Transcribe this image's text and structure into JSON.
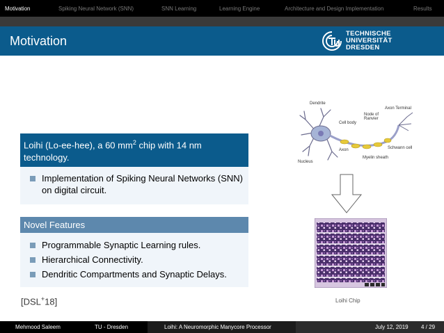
{
  "nav": {
    "items": [
      {
        "label": "Motivation",
        "active": true
      },
      {
        "label": "Spiking Neural Network (SNN)",
        "active": false
      },
      {
        "label": "SNN Learning",
        "active": false
      },
      {
        "label": "Learning Engine",
        "active": false
      },
      {
        "label": "Architecture and Design Implementation",
        "active": false
      },
      {
        "label": "Results",
        "active": false
      }
    ]
  },
  "slide": {
    "title": "Motivation",
    "logo": {
      "line1": "TECHNISCHE",
      "line2": "UNIVERSITÄT",
      "line3": "DRESDEN",
      "icon": "tu-dresden-logo-icon"
    },
    "block1": {
      "head_prefix": "Loihi (Lo-ee-hee), a 60 mm",
      "head_sup": "2",
      "head_suffix": " chip with 14 nm technology.",
      "item": "Implementation of Spiking Neural Networks (SNN) on digital circuit."
    },
    "block2": {
      "head": "Novel Features",
      "items": [
        "Programmable Synaptic Learning rules.",
        "Hierarchical Connectivity.",
        "Dendritic Compartments and Synaptic Delays."
      ]
    },
    "citation": {
      "prefix": "[DSL",
      "sup": "+",
      "suffix": "18]"
    },
    "neuron_labels": {
      "dendrite": "Dendrite",
      "axon_terminal": "Axon Terminal",
      "node_of_ranvier_1": "Node of",
      "node_of_ranvier_2": "Ranvier",
      "cell_body": "Cell body",
      "schwann_cell": "Schwann cell",
      "axon": "Axon",
      "myelin_sheath": "Myelin sheath",
      "nucleus": "Nucleus"
    },
    "chip_caption": "Loihi Chip"
  },
  "footer": {
    "author": "Mehmood Saleem",
    "institute": "TU - Dresden",
    "title": "Loihi: A Neuromorphic Manycore Processor",
    "date": "July 12, 2019",
    "page": "4 / 29"
  },
  "colors": {
    "title_bar": "#0b5b8c",
    "block2_head": "#5d88ad",
    "block_body": "#f0f5fa",
    "bullet": "#7a9cb8"
  }
}
